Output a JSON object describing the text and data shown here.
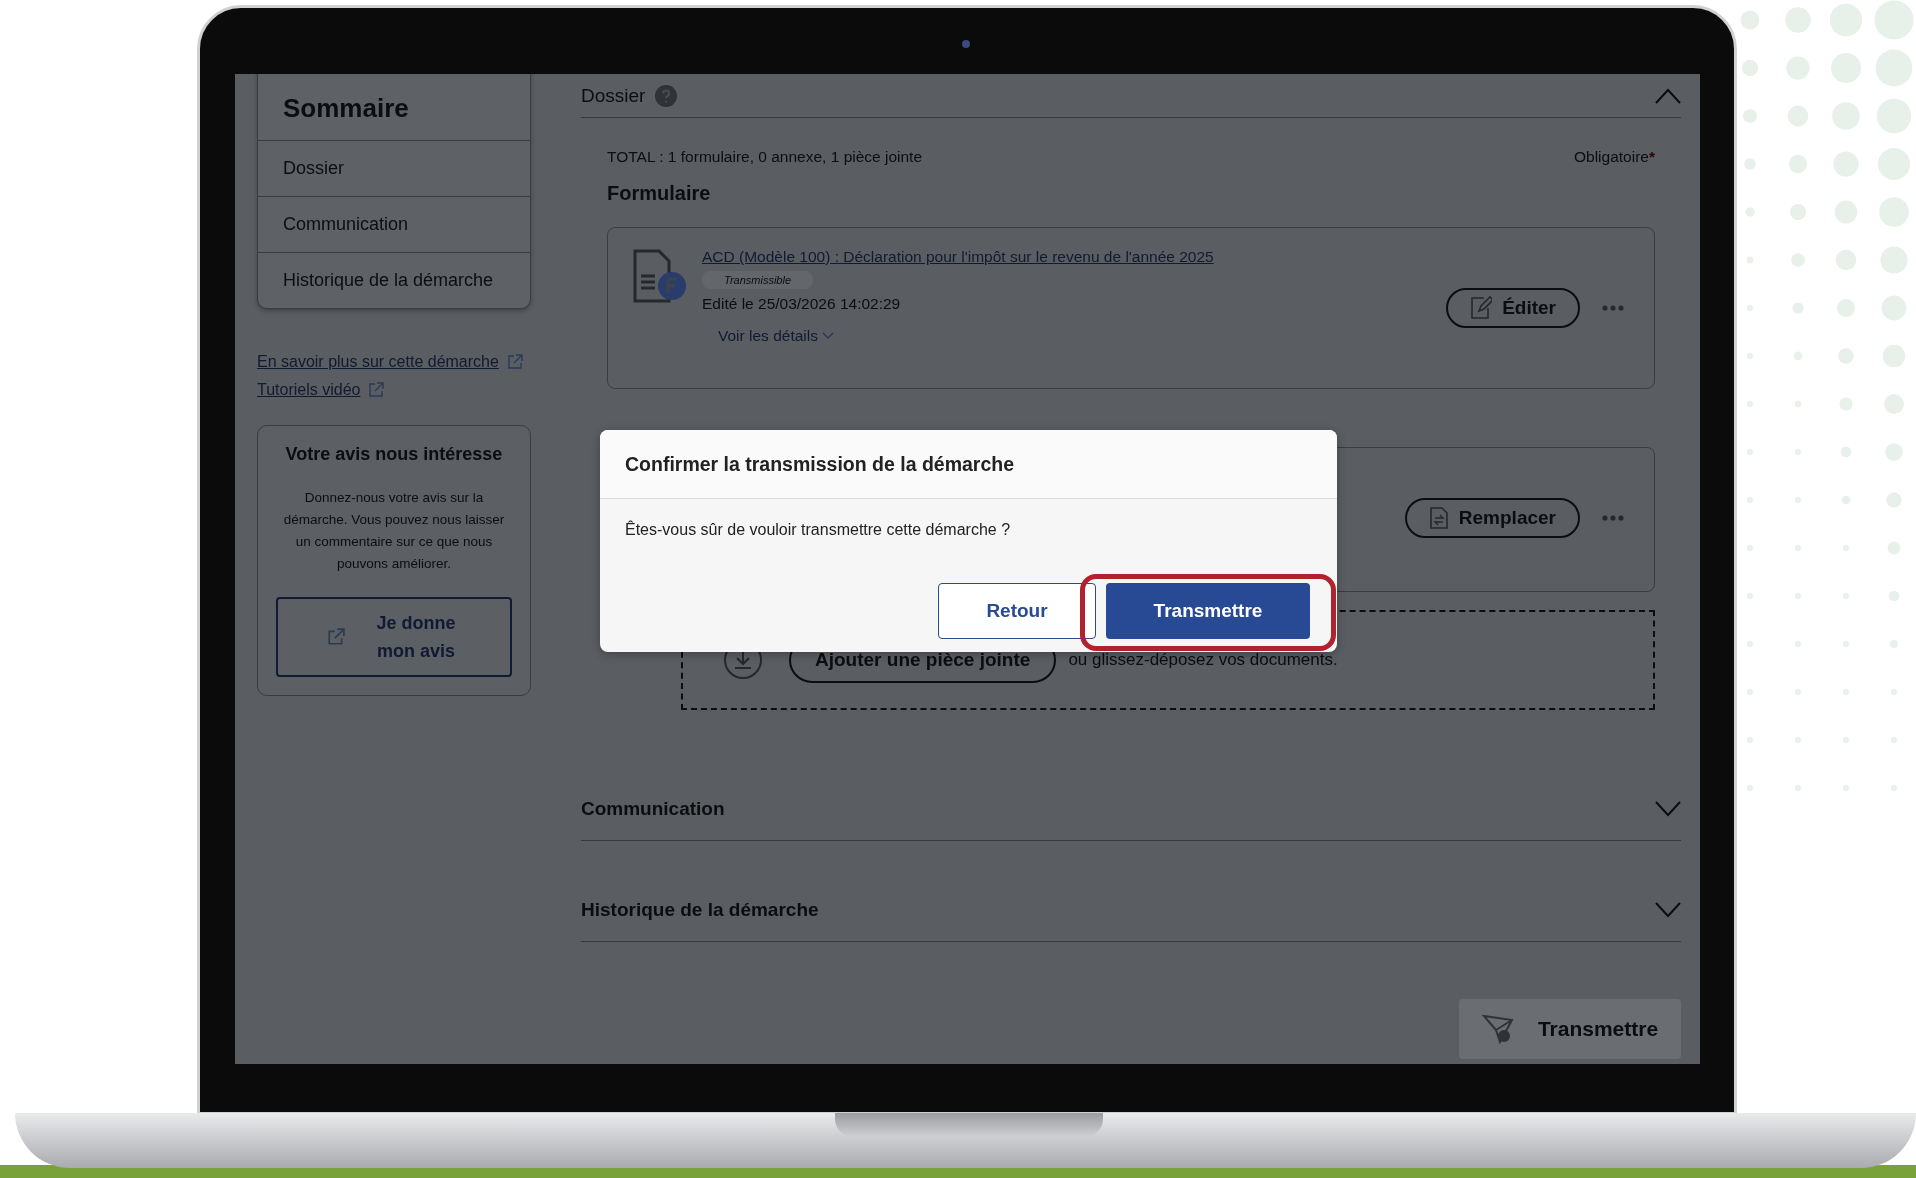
{
  "sidebar": {
    "title": "Sommaire",
    "items": [
      {
        "label": "Dossier"
      },
      {
        "label": "Communication"
      },
      {
        "label": "Historique de la démarche"
      }
    ],
    "links": [
      "En savoir plus sur cette démarche",
      "Tutoriels vidéo"
    ],
    "feedback": {
      "title": "Votre avis nous intéresse",
      "text": "Donnez-nous votre avis sur la démarche. Vous pouvez nous laisser un commentaire sur ce que nous pouvons améliorer.",
      "button": "Je donne mon avis"
    }
  },
  "main": {
    "dossier": {
      "title": "Dossier",
      "expanded": true
    },
    "total": "TOTAL : 1 formulaire, 0 annexe, 1 pièce jointe",
    "required": "Obligatoire",
    "required_mark": "*",
    "form_heading": "Formulaire",
    "form": {
      "title": "ACD (Modèle 100) : Déclaration pour l'impôt sur le revenu de l'année 2025",
      "badge": "Transmissible",
      "edited": "Edité le 25/03/2026 14:02:29",
      "details_link": "Voir les détails",
      "edit_button": "Éditer"
    },
    "attachment": {
      "replace_button": "Remplacer"
    },
    "dropzone": {
      "button": "Ajouter une pièce jointe",
      "text": "ou glissez-déposez vos documents."
    },
    "sections": [
      {
        "title": "Communication",
        "expanded": false
      },
      {
        "title": "Historique de la démarche",
        "expanded": false
      }
    ],
    "submit_button": "Transmettre"
  },
  "dialog": {
    "title": "Confirmer la transmission de la démarche",
    "message": "Êtes-vous sûr de vouloir transmettre cette démarche ?",
    "buttons": [
      {
        "label": "Retour",
        "kind": "secondary",
        "highlighted": false
      },
      {
        "label": "Transmettre",
        "kind": "primary",
        "highlighted": true
      }
    ]
  }
}
